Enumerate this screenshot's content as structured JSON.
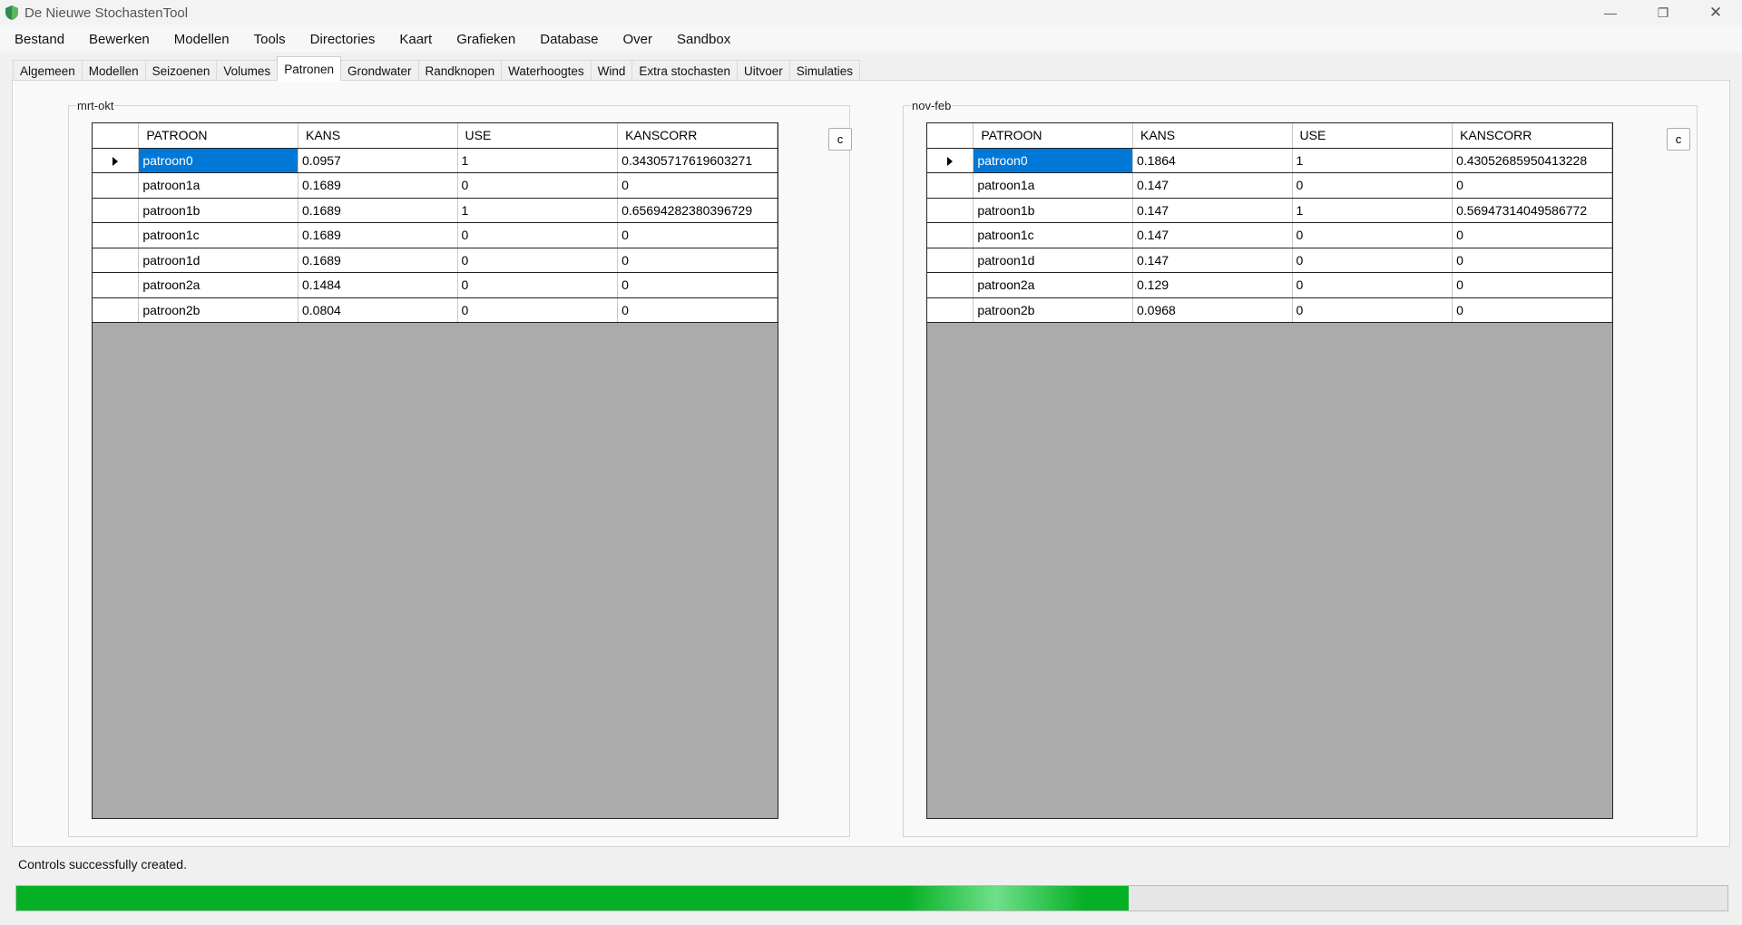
{
  "window": {
    "title": "De Nieuwe StochastenTool",
    "minimize_glyph": "—",
    "maximize_glyph": "❐",
    "close_glyph": "✕"
  },
  "menu": [
    "Bestand",
    "Bewerken",
    "Modellen",
    "Tools",
    "Directories",
    "Kaart",
    "Grafieken",
    "Database",
    "Over",
    "Sandbox"
  ],
  "tabs": [
    "Algemeen",
    "Modellen",
    "Seizoenen",
    "Volumes",
    "Patronen",
    "Grondwater",
    "Randknopen",
    "Waterhoogtes",
    "Wind",
    "Extra stochasten",
    "Uitvoer",
    "Simulaties"
  ],
  "active_tab": "Patronen",
  "groups": [
    {
      "label": "mrt-okt",
      "button_label": "c",
      "columns": [
        "PATROON",
        "KANS",
        "USE",
        "KANSCORR"
      ],
      "rows": [
        [
          "patroon0",
          "0.0957",
          "1",
          "0.343057176196032​71"
        ],
        [
          "patroon1a",
          "0.1689",
          "0",
          "0"
        ],
        [
          "patroon1b",
          "0.1689",
          "1",
          "0.65694282380396729"
        ],
        [
          "patroon1c",
          "0.1689",
          "0",
          "0"
        ],
        [
          "patroon1d",
          "0.1689",
          "0",
          "0"
        ],
        [
          "patroon2a",
          "0.1484",
          "0",
          "0"
        ],
        [
          "patroon2b",
          "0.0804",
          "0",
          "0"
        ]
      ]
    },
    {
      "label": "nov-feb",
      "button_label": "c",
      "columns": [
        "PATROON",
        "KANS",
        "USE",
        "KANSCORR"
      ],
      "rows": [
        [
          "patroon0",
          "0.1864",
          "1",
          "0.43052685950413228"
        ],
        [
          "patroon1a",
          "0.147",
          "0",
          "0"
        ],
        [
          "patroon1b",
          "0.147",
          "1",
          "0.56947314049586772"
        ],
        [
          "patroon1c",
          "0.147",
          "0",
          "0"
        ],
        [
          "patroon1d",
          "0.147",
          "0",
          "0"
        ],
        [
          "patroon2a",
          "0.129",
          "0",
          "0"
        ],
        [
          "patroon2b",
          "0.0968",
          "0",
          "0"
        ]
      ]
    }
  ],
  "status": {
    "message": "Controls successfully created.",
    "progress": 0.65
  },
  "colors": {
    "selection": "#0078d7",
    "progress": "#06b025",
    "grid_empty": "#ababab"
  }
}
